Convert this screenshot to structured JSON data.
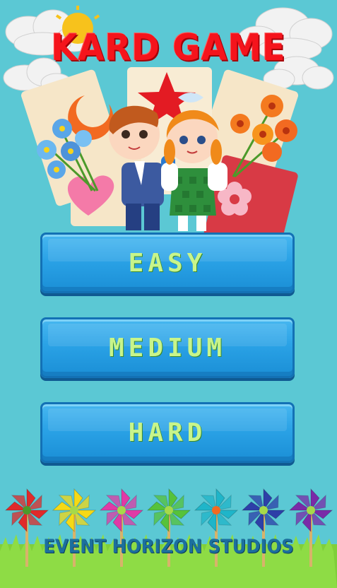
{
  "game": {
    "title": "KARD GAME",
    "studio": "EVENT HORIZON STUDIOS"
  },
  "menu": {
    "easy_label": "EASY",
    "medium_label": "MEDIUM",
    "hard_label": "HARD"
  },
  "colors": {
    "background": "#5bc8d4",
    "title_red": "#f5141c",
    "button_blue": "#2aa2e6",
    "button_text_green": "#c8f58a",
    "studio_text": "#1c6f9e"
  },
  "decorations": {
    "pinwheel_colors": [
      "#e02a2a",
      "#f5d916",
      "#e03aa6",
      "#56c23a",
      "#1fb5c9",
      "#2d3fa8",
      "#7a2aa8"
    ],
    "icons": [
      "cloud-icon",
      "sun-icon",
      "star-icon",
      "crescent-icon",
      "heart-icon",
      "flower-icon",
      "pinwheel-icon"
    ]
  }
}
